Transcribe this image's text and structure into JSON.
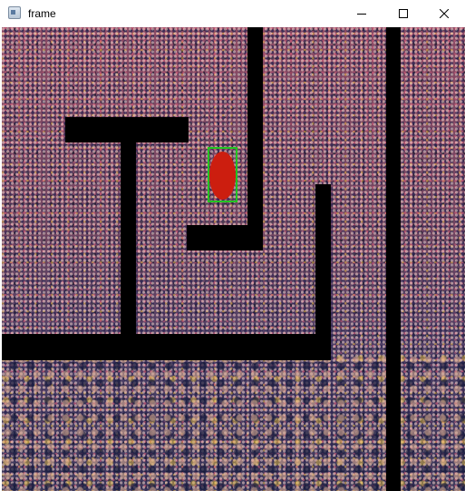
{
  "window": {
    "title": "frame"
  },
  "icons": {
    "app": "app-window-icon",
    "minimize": "minimize-icon",
    "maximize": "maximize-icon",
    "close": "close-icon"
  },
  "colors": {
    "walls": "#000000",
    "ball": "#cc1e0f",
    "detection_box": "#22c422"
  }
}
